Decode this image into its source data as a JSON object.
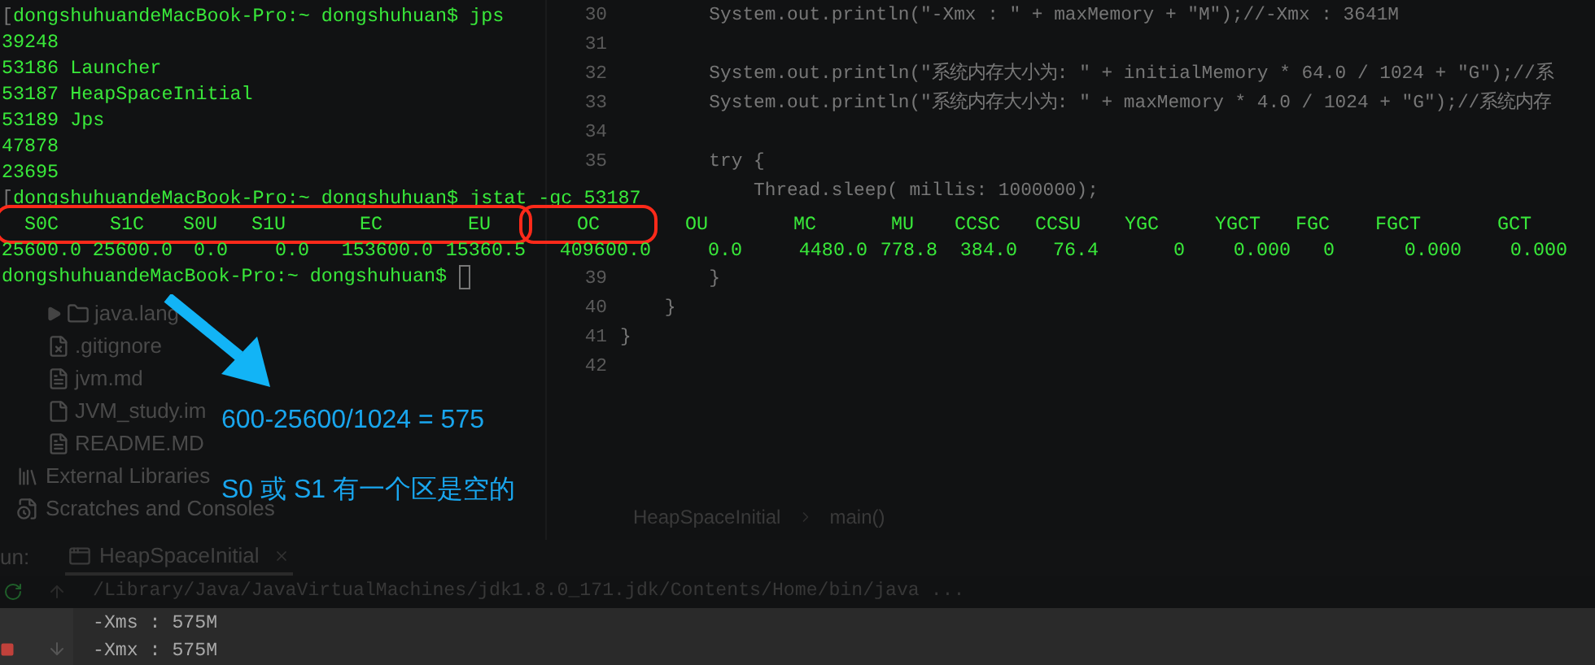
{
  "terminal": {
    "lines": [
      {
        "kind": "prompt",
        "mark": "[",
        "text": "dongshuhuandeMacBook-Pro:~ dongshuhuan$ jps"
      },
      {
        "kind": "output",
        "text": "39248"
      },
      {
        "kind": "output",
        "text": "53186 Launcher"
      },
      {
        "kind": "output",
        "text": "53187 HeapSpaceInitial"
      },
      {
        "kind": "output",
        "text": "53189 Jps"
      },
      {
        "kind": "output",
        "text": "47878"
      },
      {
        "kind": "output",
        "text": "23695"
      },
      {
        "kind": "prompt",
        "mark": "[",
        "text": "dongshuhuandeMacBook-Pro:~ dongshuhuan$ jstat -gc 53187"
      }
    ],
    "stat_groups": [
      {
        "boxed": true,
        "columns": [
          {
            "header": "S0C",
            "value": "25600.0"
          },
          {
            "header": "S1C",
            "value": "25600.0"
          },
          {
            "header": "S0U",
            "value": "0.0"
          },
          {
            "header": "S1U",
            "value": "0.0"
          },
          {
            "header": "EC",
            "value": "153600.0"
          },
          {
            "header": "EU",
            "value": "15360.5"
          }
        ]
      },
      {
        "boxed": true,
        "columns": [
          {
            "header": "OC",
            "value": "409600.0"
          }
        ]
      },
      {
        "columns": [
          {
            "header": "OU",
            "value": "0.0"
          },
          {
            "header": "MC",
            "value": "4480.0"
          },
          {
            "header": "MU",
            "value": "778.8"
          },
          {
            "header": "CCSC",
            "value": "384.0"
          },
          {
            "header": "CCSU",
            "value": "76.4"
          },
          {
            "header": "YGC",
            "value": "0"
          },
          {
            "header": "YGCT",
            "value": "0.000"
          },
          {
            "header": "FGC",
            "value": "0"
          },
          {
            "header": "FGCT",
            "value": "0.000"
          },
          {
            "header": "GCT",
            "value": "0.000"
          }
        ]
      }
    ],
    "final_prompt": {
      "text": "dongshuhuandeMacBook-Pro:~ dongshuhuan$",
      "cursor": true
    }
  },
  "annotations": [
    "600-25600/1024 = 575",
    "S0 或 S1 有一个区是空的"
  ],
  "project_tree": {
    "files": [
      {
        "kind": "folder",
        "label": "java.lang"
      },
      {
        "kind": "ignore",
        "label": ".gitignore"
      },
      {
        "kind": "markdown",
        "label": "jvm.md"
      },
      {
        "kind": "module",
        "label": "JVM_study.im"
      },
      {
        "kind": "markdown",
        "label": "README.MD"
      }
    ],
    "roots": [
      {
        "kind": "libraries",
        "label": "External Libraries"
      },
      {
        "kind": "scratches",
        "label": "Scratches and Consoles"
      }
    ]
  },
  "editor": {
    "upper_lines": [
      {
        "number": "30",
        "text": "        System.out.println(\"-Xmx : \" + maxMemory + \"M\");//-Xmx : 3641M"
      },
      {
        "number": "31"
      },
      {
        "number": "32",
        "text": "        System.out.println(\"系统内存大小为: \" + initialMemory * 64.0 / 1024 + \"G\");//系"
      },
      {
        "number": "33",
        "text": "        System.out.println(\"系统内存大小为: \" + maxMemory * 4.0 / 1024 + \"G\");//系统内存"
      },
      {
        "number": "34"
      },
      {
        "number": "35",
        "text": "        try {"
      },
      {
        "text": "            Thread.sleep( millis: 1000000);"
      }
    ],
    "lower_lines": [
      {
        "number": "39",
        "text": "        }"
      },
      {
        "number": "40",
        "text": "    }"
      },
      {
        "number": "41",
        "text": "}"
      },
      {
        "number": "42"
      }
    ],
    "breadcrumb": [
      "HeapSpaceInitial",
      "main()"
    ]
  },
  "run_panel": {
    "label": "un:",
    "tab": "HeapSpaceInitial",
    "command": "/Library/Java/JavaVirtualMachines/jdk1.8.0_171.jdk/Contents/Home/bin/java ...",
    "output": [
      "-Xms : 575M",
      "-Xmx : 575M"
    ]
  }
}
